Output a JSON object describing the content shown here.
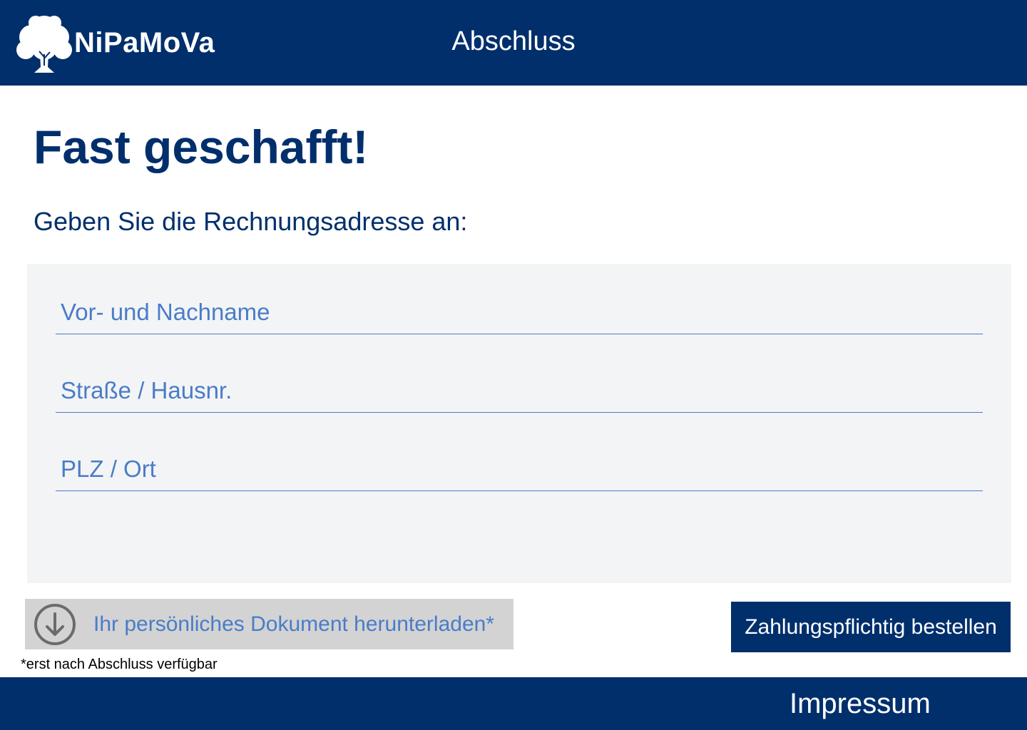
{
  "header": {
    "brand_name": "NiPaMoVa",
    "logo_icon": "tree-icon",
    "page_title": "Abschluss"
  },
  "main": {
    "headline": "Fast geschafft!",
    "subheadline": "Geben Sie die Rechnungsadresse an:",
    "form": {
      "name_placeholder": "Vor- und Nachname",
      "street_placeholder": "Straße / Hausnr.",
      "city_placeholder": "PLZ / Ort",
      "name_value": "",
      "street_value": "",
      "city_value": ""
    },
    "download": {
      "icon": "download-arrow-icon",
      "label": "Ihr persönliches Dokument herunterladen*",
      "footnote": "*erst nach Abschluss verfügbar"
    },
    "order_button_label": "Zahlungspflichtig bestellen"
  },
  "footer": {
    "impressum_label": "Impressum"
  },
  "colors": {
    "primary_navy": "#002f6c",
    "field_blue": "#4a7cc8",
    "panel_gray": "#f3f4f5",
    "disabled_gray": "#d3d3d3"
  }
}
